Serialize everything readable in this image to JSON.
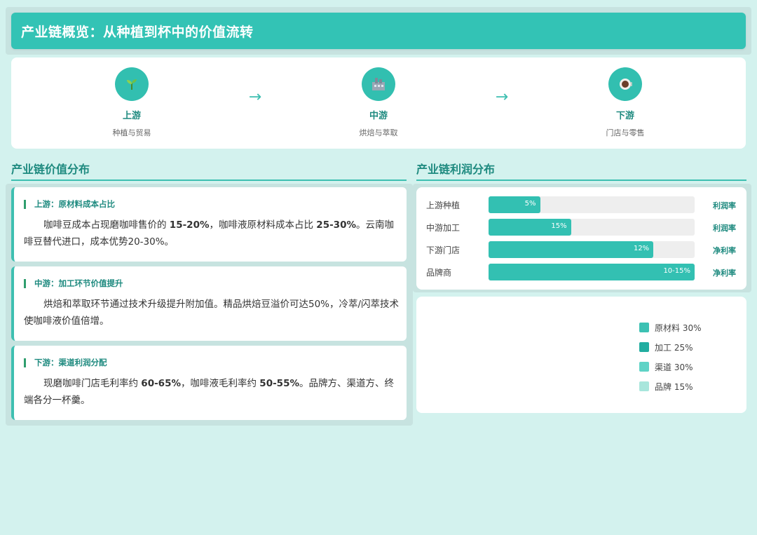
{
  "header": {
    "title": "产业链概览：从种植到杯中的价值流转"
  },
  "flow": {
    "stages": [
      {
        "name": "上游",
        "sub": "种植与贸易",
        "icon": "seedling-icon"
      },
      {
        "name": "中游",
        "sub": "烘焙与萃取",
        "icon": "factory-icon"
      },
      {
        "name": "下游",
        "sub": "门店与零售",
        "icon": "coffee-cup-icon"
      }
    ],
    "arrow": "→"
  },
  "value_section": {
    "title": "产业链价值分布",
    "cards": [
      {
        "head": "上游：原材料成本占比",
        "t1": "咖啡豆成本占现磨咖啡售价的 ",
        "b1": "15-20%",
        "t2": "，咖啡液原材料成本占比 ",
        "b2": "25-30%",
        "t3": "。云南咖啡豆替代进口，成本优势20-30%。"
      },
      {
        "head": "中游：加工环节价值提升",
        "t1": "烘焙和萃取环节通过技术升级提升附加值。精品烘焙豆溢价可达50%，冷萃/闪萃技术使咖啡液价值倍增。",
        "b1": "",
        "t2": "",
        "b2": "",
        "t3": ""
      },
      {
        "head": "下游：渠道利润分配",
        "t1": "现磨咖啡门店毛利率约 ",
        "b1": "60-65%",
        "t2": "，咖啡液毛利率约 ",
        "b2": "50-55%",
        "t3": "。品牌方、渠道方、终端各分一杯羹。"
      }
    ]
  },
  "profit_section": {
    "title": "产业链利润分布",
    "rows": [
      {
        "label": "上游种植",
        "value": "5%",
        "type": "利润率",
        "fill": 0.25
      },
      {
        "label": "中游加工",
        "value": "15%",
        "type": "利润率",
        "fill": 0.4
      },
      {
        "label": "下游门店",
        "value": "12%",
        "type": "净利率",
        "fill": 0.8
      },
      {
        "label": "品牌商",
        "value": "10-15%",
        "type": "净利率",
        "fill": 1.0
      }
    ],
    "legend": [
      {
        "label": "原材料 30%",
        "color": "#3cc1b3"
      },
      {
        "label": "加工 25%",
        "color": "#22ada0"
      },
      {
        "label": "渠道 30%",
        "color": "#5fd3c6"
      },
      {
        "label": "品牌 15%",
        "color": "#a8e6dc"
      }
    ]
  }
}
